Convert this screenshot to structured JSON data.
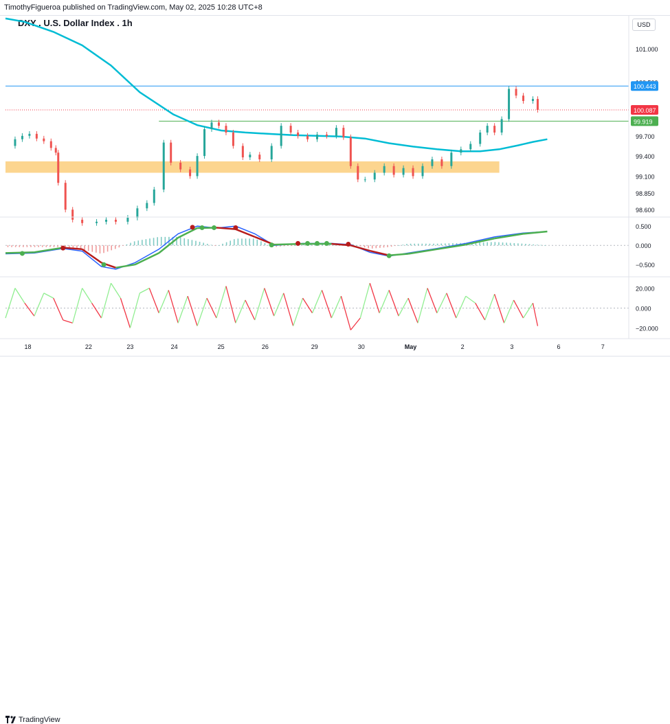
{
  "header": {
    "published": "TimothyFigueroa published on TradingView.com, May 02, 2025 10:28 UTC+8"
  },
  "chart_title": "DXY . U.S. Dollar Index . 1h",
  "currency": "USD",
  "footer": {
    "brand": "TradingView"
  },
  "colors": {
    "ma_line": "#00bcd4",
    "zone": "#f9b233",
    "upper_line": "#2196f3",
    "current_price": "#f23645",
    "support_line": "#26a69a",
    "macd_fast": "#2962ff",
    "macd_slow_up": "#4caf50",
    "macd_slow_down": "#b71c1c",
    "osc_up": "#90ee90",
    "osc_down": "#f23645"
  },
  "chart_data": [
    {
      "type": "candlestick",
      "title": "DXY . U.S. Dollar Index . 1h",
      "x_labels": [
        "18",
        "22",
        "23",
        "24",
        "25",
        "26",
        "29",
        "30",
        "May",
        "2",
        "3",
        "6",
        "7"
      ],
      "y_ticks": [
        "101.000",
        "100.500",
        "99.700",
        "99.400",
        "99.100",
        "98.850",
        "98.600"
      ],
      "ylim": [
        98.5,
        101.5
      ],
      "price_labels": [
        {
          "label": "100.443",
          "value": 100.443,
          "color": "#2196f3"
        },
        {
          "label": "100.087",
          "value": 100.087,
          "color": "#f23645"
        },
        {
          "label": "99.919",
          "value": 99.919,
          "color": "#4caf50"
        }
      ],
      "zone": {
        "top": 99.32,
        "bottom": 99.15,
        "color": "#f9b233"
      },
      "ma_series": [
        {
          "x": 0,
          "y": 101.45
        },
        {
          "x": 0.4,
          "y": 101.4
        },
        {
          "x": 1.0,
          "y": 101.25
        },
        {
          "x": 1.6,
          "y": 101.05
        },
        {
          "x": 2.2,
          "y": 100.75
        },
        {
          "x": 2.8,
          "y": 100.35
        },
        {
          "x": 3.5,
          "y": 100.02
        },
        {
          "x": 4.0,
          "y": 99.86
        },
        {
          "x": 4.5,
          "y": 99.78
        },
        {
          "x": 5.0,
          "y": 99.75
        },
        {
          "x": 5.5,
          "y": 99.73
        },
        {
          "x": 6.0,
          "y": 99.71
        },
        {
          "x": 6.5,
          "y": 99.7
        },
        {
          "x": 7.0,
          "y": 99.69
        },
        {
          "x": 7.5,
          "y": 99.66
        },
        {
          "x": 8.0,
          "y": 99.59
        },
        {
          "x": 8.5,
          "y": 99.54
        },
        {
          "x": 9.0,
          "y": 99.5
        },
        {
          "x": 9.5,
          "y": 99.47
        },
        {
          "x": 9.9,
          "y": 99.47
        },
        {
          "x": 10.3,
          "y": 99.5
        },
        {
          "x": 10.7,
          "y": 99.56
        },
        {
          "x": 11.0,
          "y": 99.61
        },
        {
          "x": 11.3,
          "y": 99.65
        }
      ],
      "price_series": [
        {
          "x": 0.1,
          "y": 99.55
        },
        {
          "x": 0.2,
          "y": 99.65
        },
        {
          "x": 0.35,
          "y": 99.7
        },
        {
          "x": 0.5,
          "y": 99.73
        },
        {
          "x": 0.65,
          "y": 99.66
        },
        {
          "x": 0.8,
          "y": 99.62
        },
        {
          "x": 0.95,
          "y": 99.52
        },
        {
          "x": 1.05,
          "y": 99.45
        },
        {
          "x": 1.1,
          "y": 99.0
        },
        {
          "x": 1.25,
          "y": 98.6
        },
        {
          "x": 1.4,
          "y": 98.45
        },
        {
          "x": 1.6,
          "y": 98.4
        },
        {
          "x": 1.9,
          "y": 98.42
        },
        {
          "x": 2.1,
          "y": 98.45
        },
        {
          "x": 2.3,
          "y": 98.42
        },
        {
          "x": 2.55,
          "y": 98.48
        },
        {
          "x": 2.75,
          "y": 98.62
        },
        {
          "x": 2.95,
          "y": 98.7
        },
        {
          "x": 3.1,
          "y": 98.9
        },
        {
          "x": 3.3,
          "y": 99.6
        },
        {
          "x": 3.45,
          "y": 99.3
        },
        {
          "x": 3.65,
          "y": 99.2
        },
        {
          "x": 3.85,
          "y": 99.1
        },
        {
          "x": 4.0,
          "y": 99.4
        },
        {
          "x": 4.15,
          "y": 99.8
        },
        {
          "x": 4.3,
          "y": 99.9
        },
        {
          "x": 4.45,
          "y": 99.85
        },
        {
          "x": 4.6,
          "y": 99.75
        },
        {
          "x": 4.75,
          "y": 99.55
        },
        {
          "x": 4.95,
          "y": 99.38
        },
        {
          "x": 5.1,
          "y": 99.42
        },
        {
          "x": 5.3,
          "y": 99.35
        },
        {
          "x": 5.55,
          "y": 99.55
        },
        {
          "x": 5.75,
          "y": 99.85
        },
        {
          "x": 5.95,
          "y": 99.75
        },
        {
          "x": 6.1,
          "y": 99.7
        },
        {
          "x": 6.3,
          "y": 99.65
        },
        {
          "x": 6.5,
          "y": 99.72
        },
        {
          "x": 6.7,
          "y": 99.7
        },
        {
          "x": 6.9,
          "y": 99.82
        },
        {
          "x": 7.05,
          "y": 99.68
        },
        {
          "x": 7.2,
          "y": 99.25
        },
        {
          "x": 7.35,
          "y": 99.05
        },
        {
          "x": 7.5,
          "y": 99.05
        },
        {
          "x": 7.7,
          "y": 99.15
        },
        {
          "x": 7.9,
          "y": 99.25
        },
        {
          "x": 8.1,
          "y": 99.12
        },
        {
          "x": 8.3,
          "y": 99.22
        },
        {
          "x": 8.5,
          "y": 99.1
        },
        {
          "x": 8.7,
          "y": 99.25
        },
        {
          "x": 8.9,
          "y": 99.35
        },
        {
          "x": 9.1,
          "y": 99.25
        },
        {
          "x": 9.3,
          "y": 99.45
        },
        {
          "x": 9.5,
          "y": 99.5
        },
        {
          "x": 9.7,
          "y": 99.58
        },
        {
          "x": 9.9,
          "y": 99.75
        },
        {
          "x": 10.05,
          "y": 99.85
        },
        {
          "x": 10.2,
          "y": 99.75
        },
        {
          "x": 10.35,
          "y": 99.95
        },
        {
          "x": 10.5,
          "y": 100.4
        },
        {
          "x": 10.65,
          "y": 100.3
        },
        {
          "x": 10.8,
          "y": 100.22
        },
        {
          "x": 11.0,
          "y": 100.25
        },
        {
          "x": 11.1,
          "y": 100.087
        }
      ]
    },
    {
      "type": "line",
      "title": "",
      "y_ticks": [
        "0.500",
        "0.000",
        "−0.500"
      ],
      "ylim": [
        -0.8,
        0.7
      ],
      "series": [
        {
          "values": [
            {
              "x": 0,
              "y": -0.22
            },
            {
              "x": 0.6,
              "y": -0.2
            },
            {
              "x": 1.2,
              "y": -0.08
            },
            {
              "x": 1.6,
              "y": -0.15
            },
            {
              "x": 2.0,
              "y": -0.55
            },
            {
              "x": 2.3,
              "y": -0.62
            },
            {
              "x": 2.7,
              "y": -0.45
            },
            {
              "x": 3.2,
              "y": -0.1
            },
            {
              "x": 3.6,
              "y": 0.3
            },
            {
              "x": 4.0,
              "y": 0.5
            },
            {
              "x": 4.4,
              "y": 0.45
            },
            {
              "x": 4.8,
              "y": 0.5
            },
            {
              "x": 5.2,
              "y": 0.3
            },
            {
              "x": 5.6,
              "y": 0.0
            },
            {
              "x": 6.2,
              "y": 0.05
            },
            {
              "x": 6.8,
              "y": 0.05
            },
            {
              "x": 7.2,
              "y": 0.02
            },
            {
              "x": 7.6,
              "y": -0.18
            },
            {
              "x": 8.0,
              "y": -0.28
            },
            {
              "x": 8.4,
              "y": -0.2
            },
            {
              "x": 9.0,
              "y": -0.08
            },
            {
              "x": 9.6,
              "y": 0.05
            },
            {
              "x": 10.2,
              "y": 0.22
            },
            {
              "x": 10.8,
              "y": 0.32
            },
            {
              "x": 11.3,
              "y": 0.36
            }
          ]
        },
        {
          "values": [
            {
              "x": 0,
              "y": -0.2
            },
            {
              "x": 0.6,
              "y": -0.18
            },
            {
              "x": 1.2,
              "y": -0.06
            },
            {
              "x": 1.6,
              "y": -0.1
            },
            {
              "x": 2.0,
              "y": -0.45
            },
            {
              "x": 2.3,
              "y": -0.58
            },
            {
              "x": 2.7,
              "y": -0.5
            },
            {
              "x": 3.2,
              "y": -0.2
            },
            {
              "x": 3.6,
              "y": 0.2
            },
            {
              "x": 4.0,
              "y": 0.45
            },
            {
              "x": 4.4,
              "y": 0.46
            },
            {
              "x": 4.8,
              "y": 0.42
            },
            {
              "x": 5.2,
              "y": 0.22
            },
            {
              "x": 5.6,
              "y": 0.02
            },
            {
              "x": 6.2,
              "y": 0.04
            },
            {
              "x": 6.8,
              "y": 0.04
            },
            {
              "x": 7.2,
              "y": 0.0
            },
            {
              "x": 7.6,
              "y": -0.14
            },
            {
              "x": 8.0,
              "y": -0.26
            },
            {
              "x": 8.4,
              "y": -0.22
            },
            {
              "x": 9.0,
              "y": -0.1
            },
            {
              "x": 9.6,
              "y": 0.02
            },
            {
              "x": 10.2,
              "y": 0.18
            },
            {
              "x": 10.8,
              "y": 0.3
            },
            {
              "x": 11.3,
              "y": 0.36
            }
          ]
        }
      ]
    },
    {
      "type": "line",
      "title": "",
      "y_ticks": [
        "20.000",
        "0.000",
        "−20.000"
      ],
      "ylim": [
        -30,
        30
      ],
      "series": [
        {
          "values": [
            {
              "x": 0,
              "y": -10
            },
            {
              "x": 0.2,
              "y": 20
            },
            {
              "x": 0.4,
              "y": 5
            },
            {
              "x": 0.6,
              "y": -8
            },
            {
              "x": 0.8,
              "y": 15
            },
            {
              "x": 1.0,
              "y": 10
            },
            {
              "x": 1.2,
              "y": -12
            },
            {
              "x": 1.4,
              "y": -15
            },
            {
              "x": 1.6,
              "y": 20
            },
            {
              "x": 1.8,
              "y": 5
            },
            {
              "x": 2.0,
              "y": -10
            },
            {
              "x": 2.2,
              "y": 25
            },
            {
              "x": 2.4,
              "y": 10
            },
            {
              "x": 2.6,
              "y": -20
            },
            {
              "x": 2.8,
              "y": 15
            },
            {
              "x": 3.0,
              "y": 20
            },
            {
              "x": 3.2,
              "y": -5
            },
            {
              "x": 3.4,
              "y": 18
            },
            {
              "x": 3.6,
              "y": -15
            },
            {
              "x": 3.8,
              "y": 12
            },
            {
              "x": 4.0,
              "y": -18
            },
            {
              "x": 4.2,
              "y": 10
            },
            {
              "x": 4.4,
              "y": -10
            },
            {
              "x": 4.6,
              "y": 22
            },
            {
              "x": 4.8,
              "y": -15
            },
            {
              "x": 5.0,
              "y": 8
            },
            {
              "x": 5.2,
              "y": -12
            },
            {
              "x": 5.4,
              "y": 20
            },
            {
              "x": 5.6,
              "y": -8
            },
            {
              "x": 5.8,
              "y": 15
            },
            {
              "x": 6.0,
              "y": -18
            },
            {
              "x": 6.2,
              "y": 10
            },
            {
              "x": 6.4,
              "y": -5
            },
            {
              "x": 6.6,
              "y": 18
            },
            {
              "x": 6.8,
              "y": -10
            },
            {
              "x": 7.0,
              "y": 12
            },
            {
              "x": 7.2,
              "y": -22
            },
            {
              "x": 7.4,
              "y": -10
            },
            {
              "x": 7.6,
              "y": 25
            },
            {
              "x": 7.8,
              "y": -5
            },
            {
              "x": 8.0,
              "y": 18
            },
            {
              "x": 8.2,
              "y": -8
            },
            {
              "x": 8.4,
              "y": 10
            },
            {
              "x": 8.6,
              "y": -15
            },
            {
              "x": 8.8,
              "y": 20
            },
            {
              "x": 9.0,
              "y": -5
            },
            {
              "x": 9.2,
              "y": 15
            },
            {
              "x": 9.4,
              "y": -10
            },
            {
              "x": 9.6,
              "y": 12
            },
            {
              "x": 9.8,
              "y": 5
            },
            {
              "x": 10.0,
              "y": -12
            },
            {
              "x": 10.2,
              "y": 14
            },
            {
              "x": 10.4,
              "y": -15
            },
            {
              "x": 10.6,
              "y": 8
            },
            {
              "x": 10.8,
              "y": -10
            },
            {
              "x": 11.0,
              "y": 5
            },
            {
              "x": 11.1,
              "y": -18
            }
          ]
        }
      ]
    }
  ]
}
